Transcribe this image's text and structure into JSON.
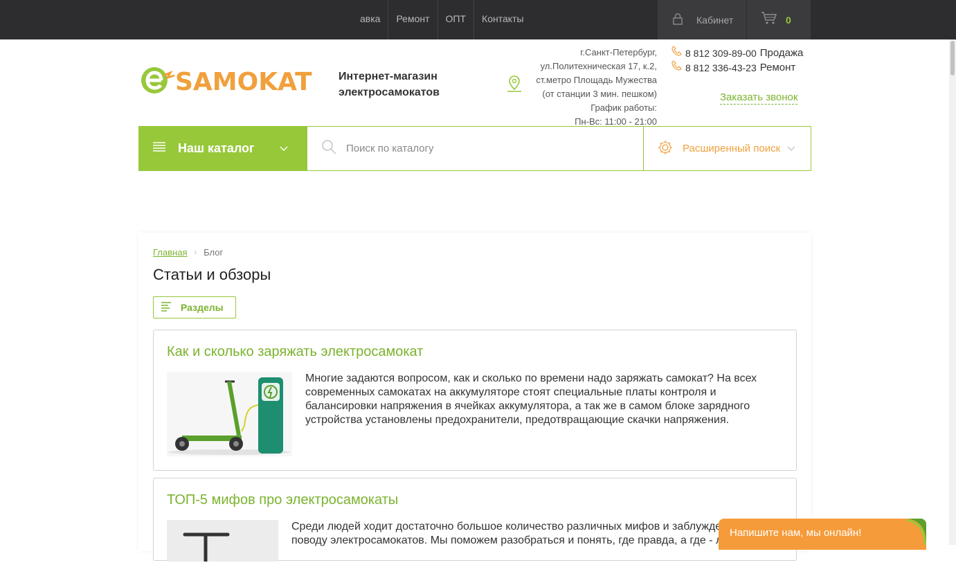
{
  "topnav": {
    "items": [
      "авка",
      "Ремонт",
      "ОПТ",
      "Контакты"
    ],
    "cabinet_label": "Кабинет",
    "cart_count": "0"
  },
  "header": {
    "logo_text": "SAMOKAT",
    "tagline_line1": "Интернет-магазин",
    "tagline_line2": "электросамокатов",
    "address_lines": [
      "г.Санкт-Петербург,",
      "ул.Политехническая 17, к.2,",
      "ст.метро Площадь Мужества",
      "(от станции 3 мин. пешком)",
      "График работы:",
      "Пн-Вс: 11:00 - 21:00"
    ],
    "phones": [
      {
        "number": "8 812 309-89-00",
        "label": "Продажа"
      },
      {
        "number": "8 812 336-43-23",
        "label": "Ремонт"
      }
    ],
    "callback_label": "Заказать звонок"
  },
  "catalog_bar": {
    "catalog_label": "Наш каталог",
    "search_placeholder": "Поиск по каталогу",
    "advanced_label": "Расширенный поиск"
  },
  "breadcrumb": {
    "home": "Главная",
    "current": "Блог"
  },
  "page_title": "Статьи и обзоры",
  "sections_label": "Разделы",
  "articles": [
    {
      "title": "Как и сколько заряжать электросамокат",
      "text": "Многие задаются вопросом, как и сколько по времени надо заряжать самокат? На всех современных самокатах на аккумуляторе стоят специальные платы контроля и балансировки напряжения в ячейках аккумулятора, а так же в самом блоке зарядного устройства установлены предохранители, предотвращающие скачки напряжения."
    },
    {
      "title": "ТОП-5 мифов про электросамокаты",
      "text_line1": "Среди людей ходит достаточно большое количество различных мифов и заблужде",
      "text_line2": "поводу электросамокатов. Мы поможем разобраться и понять, где правда, а где - л"
    }
  ],
  "chat_label": "Напишите нам, мы онлайн!",
  "colors": {
    "brand_green": "#97c83a",
    "accent_orange": "#f59b3a",
    "topbar": "#2d2c2e"
  }
}
